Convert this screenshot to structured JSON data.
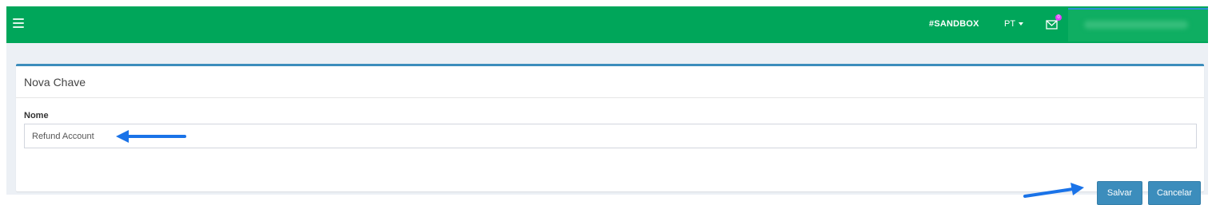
{
  "navbar": {
    "menu_icon": "hamburger-icon",
    "environment_label": "#SANDBOX",
    "language_label": "PT",
    "language_caret_icon": "caret-down-icon",
    "mail_icon": "envelope-icon",
    "mail_badge_count": "0",
    "accent_color": "#00a65a"
  },
  "form": {
    "title": "Nova Chave",
    "name_label": "Nome",
    "name_value": "Refund Account",
    "save_label": "Salvar",
    "cancel_label": "Cancelar",
    "button_color": "#3c8dbc"
  },
  "annotations": {
    "arrow_color": "#1a73e8"
  }
}
